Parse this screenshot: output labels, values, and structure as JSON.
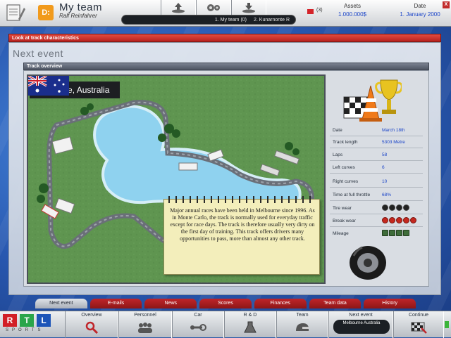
{
  "header": {
    "team_title": "My team",
    "team_subtitle": "Ralf Reinfahrer",
    "team_logo_text": "D:",
    "tabs": [
      "1. My team (0)",
      "2. Kunarnonte R"
    ],
    "messages_count": "(3)",
    "assets_label": "Assets",
    "assets_value": "1.000.000$",
    "date_label": "Date",
    "date_value": "1. January 2000",
    "close_label": "X"
  },
  "panel": {
    "header": "Look at track characteristics",
    "title": "Next event",
    "overview_header": "Track overview"
  },
  "track": {
    "name": "Melbourne, Australia",
    "description": "Major annual races have been held in Melbourne since 1996. As in Monte Carlo, the track is normally used for everyday traffic except for race days. The track is therefore usually very dirty on the first day of training. This track offers drivers many opportunities to pass, more than almost any other track.",
    "stats": [
      {
        "label": "Date",
        "value": "March 18th"
      },
      {
        "label": "Track length",
        "value": "5303 Metre"
      },
      {
        "label": "Laps",
        "value": "58"
      },
      {
        "label": "Left curves",
        "value": "6"
      },
      {
        "label": "Right curves",
        "value": "10"
      },
      {
        "label": "Time at full throttle",
        "value": "68%"
      }
    ],
    "ratings": [
      {
        "label": "Tire wear",
        "level": 4,
        "max": 4
      },
      {
        "label": "Break wear",
        "level": 5,
        "max": 5
      },
      {
        "label": "Mileage",
        "level": 4,
        "max": 4
      }
    ]
  },
  "subtabs": [
    "Next event",
    "E-mails",
    "News",
    "Scores",
    "Finances",
    "Team data",
    "History"
  ],
  "nav": {
    "logo_letters": [
      "R",
      "T",
      "L"
    ],
    "logo_sub": "SPORTS",
    "buttons": [
      "Overview",
      "Personnel",
      "Car",
      "R & D",
      "Team"
    ],
    "next_event_label": "Next event",
    "next_event_value": "Melbourne Australia",
    "continue_label": "Continue"
  },
  "colors": {
    "accent_red": "#c0252a",
    "value_blue": "#1a44c8",
    "water": "#8fd2ef"
  }
}
